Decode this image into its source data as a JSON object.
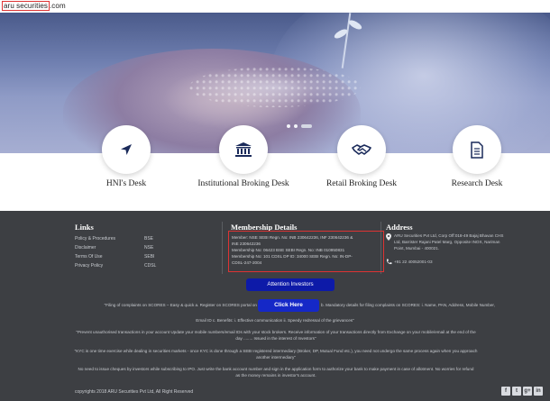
{
  "header": {
    "logo_boxed": "aru securities",
    "logo_suffix": ".com"
  },
  "desks": [
    {
      "label": "HNI's Desk",
      "icon": "arrow-icon"
    },
    {
      "label": "Institutional Broking Desk",
      "icon": "bank-icon"
    },
    {
      "label": "Retail Broking Desk",
      "icon": "handshake-icon"
    },
    {
      "label": "Research Desk",
      "icon": "document-icon"
    }
  ],
  "footer": {
    "links_title": "Links",
    "links_col1": [
      "Policy & Procedures",
      "Disclaimer",
      "Terms Of Use",
      "Privacy Policy"
    ],
    "links_col2": [
      "BSE",
      "NSE",
      "SEBI",
      "CDSL"
    ],
    "membership_title": "Membership Details",
    "membership_lines": [
      "Member: NSE SEBI Regn. No: INB 230642236, INF 230642236 &",
      "INE 230642236",
      "Membership No: 06423 BSE SEBI Regn. No: INB 010950831",
      "Membership No: 101 CDSL DP ID: 34000 SEBI Regn. No: IN-DP-",
      "CDSL-247-2004"
    ],
    "address_title": "Address",
    "address_lines": [
      "ARU Securities Pvt Ltd, Corp Off:018-49 Bajaj Bhavan CHS",
      "Ltd, Barrister Rajani Patel Marg, Opposite INOX, Nariman",
      "Point, Mumbai - 400021."
    ],
    "phone": "+91 22 40052001-03",
    "attention_button": "Attention Investors",
    "click_button": "Click Here",
    "scores_left": "\"Filing of complaints on SCORES – Easy & quick a. Register on SCORES portal on",
    "scores_right": "b. Mandatory details for filing complaints on SCORES: i. Name, PAN, Address, Mobile Number,",
    "scores_line2": "Email ID c. Benefits: i. Effective communication ii. Speedy redressal of the grievances\"",
    "notice1": "\"Prevent unauthorised transactions in your account Update your mobile numbers/email IDs with your stock brokers. Receive information of your transactions directly from Exchange on your mobile/email at the end of the day ........ Issued in the interest of Investors\"",
    "notice2": "\"KYC is one time exercise while dealing in securities markets - once KYC is done through a SEBI registered intermediary (Broker, DP, Mutual Fund etc.), you need not undergo the same process again when you approach another intermediary\"",
    "notice3": "No need to issue cheques by investors while subscribing to IPO. Just write the bank account number and sign in the application form to authorize your bank to make payment in case of allotment. No worries for refund as the money remains in investor's account.",
    "copyright": "copyrights 2018 ARU Securities Pvt Ltd, All Right Reserved",
    "social": [
      "f",
      "t",
      "g+",
      "in"
    ]
  }
}
